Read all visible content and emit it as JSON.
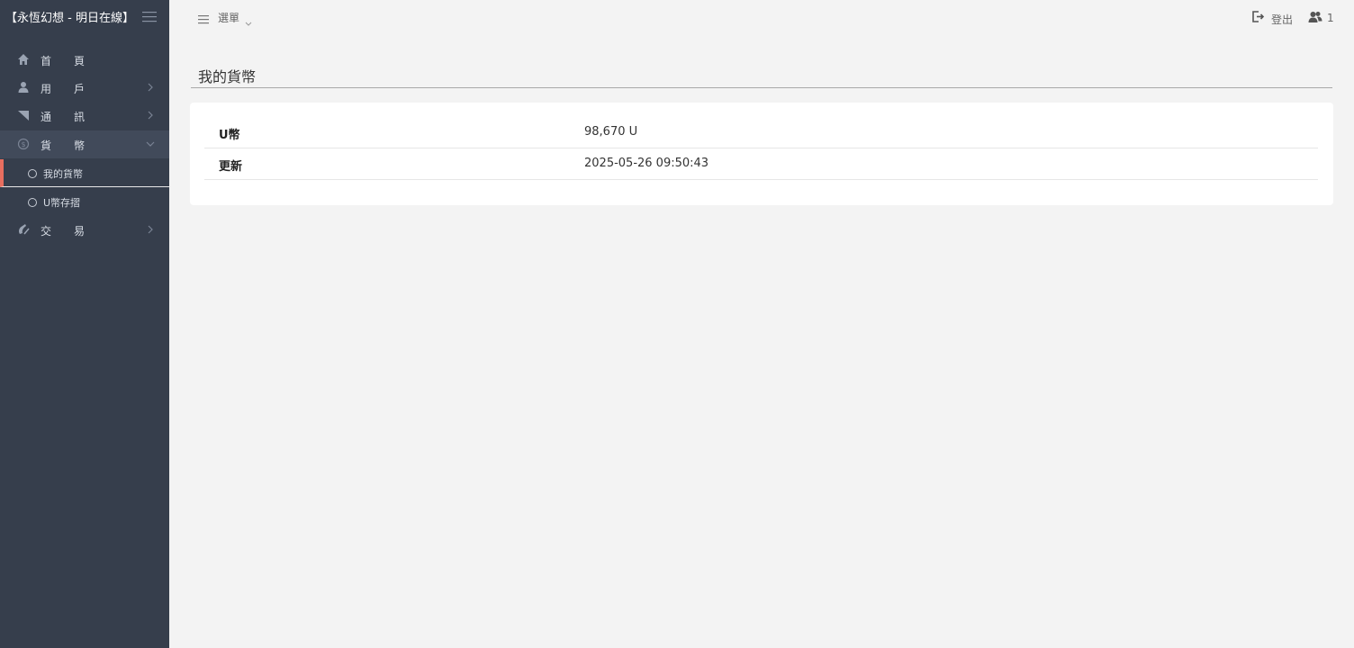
{
  "brand": {
    "title": "【永恆幻想 - 明日在線】"
  },
  "sidebar": {
    "items": [
      {
        "label": "首頁",
        "icon": "home-icon"
      },
      {
        "label": "用戶",
        "icon": "user-icon"
      },
      {
        "label": "通訊",
        "icon": "message-icon"
      },
      {
        "label": "貨幣",
        "icon": "coin-icon"
      },
      {
        "label": "交易",
        "icon": "trade-icon"
      }
    ],
    "subitems": [
      {
        "label": "我的貨幣"
      },
      {
        "label": "U幣存摺"
      }
    ]
  },
  "topbar": {
    "menu_label": "選單",
    "logout_label": "登出",
    "online_count": "1"
  },
  "main": {
    "title": "我的貨幣",
    "rows": [
      {
        "key": "U幣",
        "value": "98,670 U"
      },
      {
        "key": "更新",
        "value": "2025-05-26 09:50:43"
      }
    ]
  },
  "colors": {
    "sidebar_bg": "#363e4c",
    "active_accent": "#e86e5f",
    "page_bg": "#f3f3f3"
  }
}
